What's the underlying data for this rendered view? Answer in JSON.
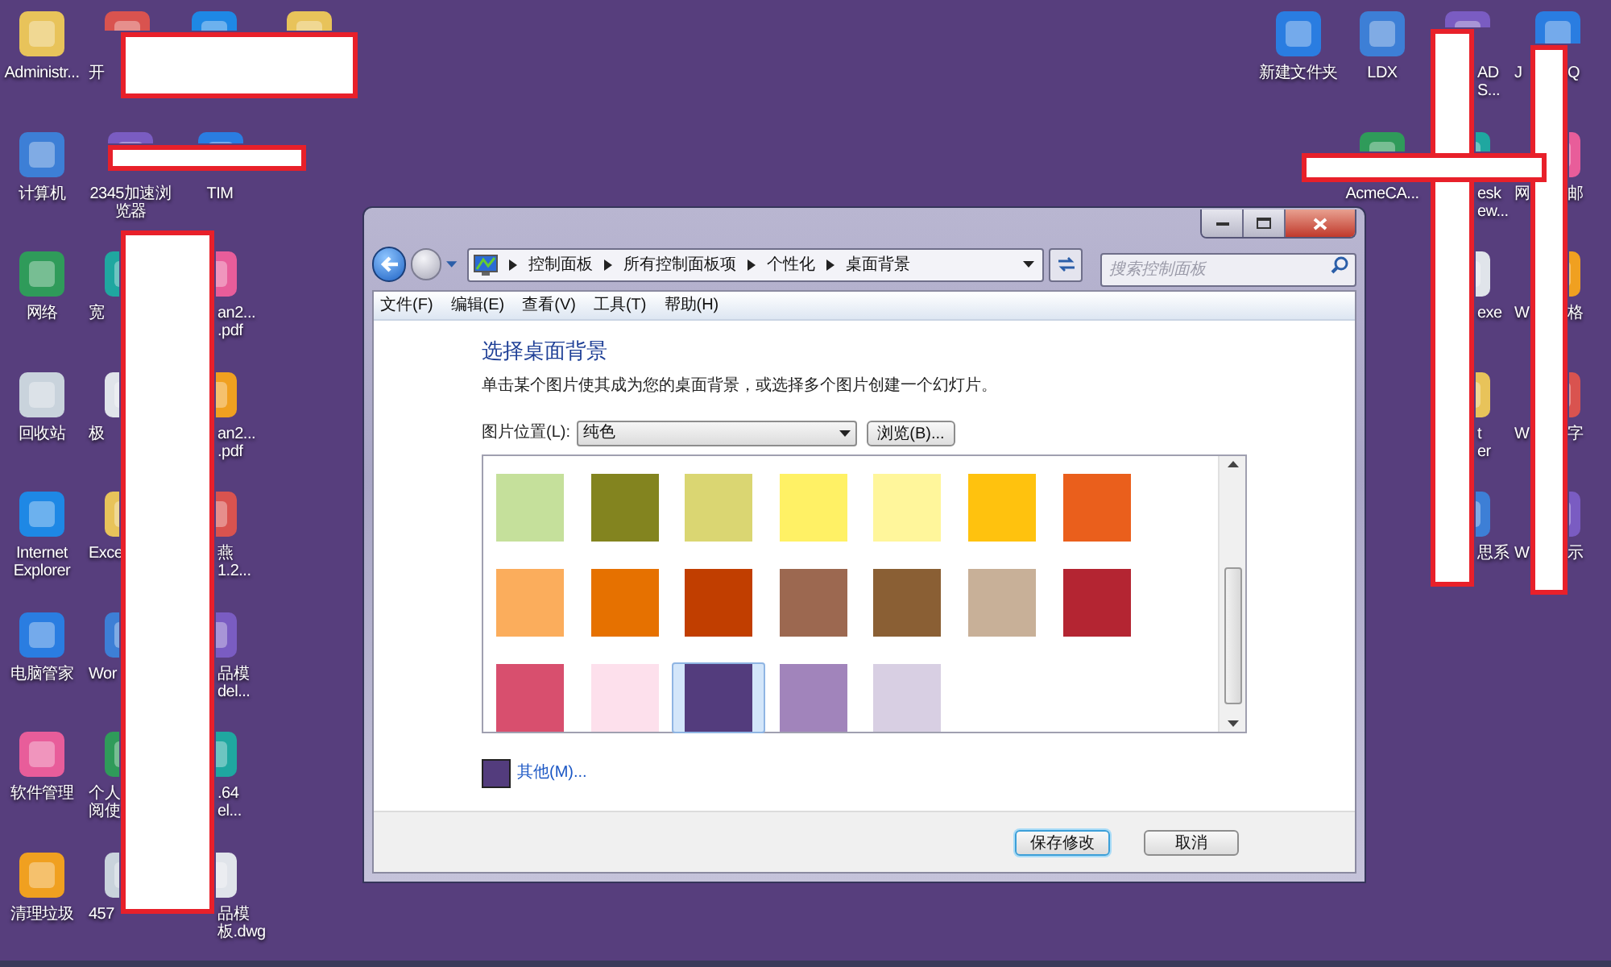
{
  "desktop": {
    "left_columns": [
      [
        {
          "kind": "full",
          "lines": [
            "Administr..."
          ]
        },
        {
          "kind": "full",
          "lines": [
            "计算机"
          ]
        },
        {
          "kind": "full",
          "lines": [
            "网络"
          ]
        },
        {
          "kind": "full",
          "lines": [
            "回收站"
          ]
        },
        {
          "kind": "full",
          "lines": [
            "Internet",
            "Explorer"
          ]
        },
        {
          "kind": "full",
          "lines": [
            "电脑管家"
          ]
        },
        {
          "kind": "full",
          "lines": [
            "软件管理"
          ]
        },
        {
          "kind": "full",
          "lines": [
            "清理垃圾"
          ]
        }
      ],
      [
        {
          "kind": "cut_right",
          "lines": [
            "开"
          ]
        },
        {
          "kind": "full",
          "lines": [
            "2345加速浏",
            "览器"
          ]
        },
        {
          "kind": "cut_right",
          "lines": [
            "宽"
          ]
        },
        {
          "kind": "cut_right",
          "lines": [
            "极"
          ]
        },
        {
          "kind": "cut_right",
          "lines": [
            "Exce"
          ]
        },
        {
          "kind": "cut_right",
          "lines": [
            "Wor"
          ]
        },
        {
          "kind": "cut_right",
          "lines": [
            "个人",
            "阅使"
          ]
        },
        {
          "kind": "cut_right",
          "lines": [
            "457"
          ]
        }
      ],
      [
        {
          "kind": "icon_only"
        },
        {
          "kind": "full",
          "lines": [
            "TIM"
          ]
        },
        {
          "kind": "cut_left",
          "lines": [
            "an2...",
            ".pdf"
          ]
        },
        {
          "kind": "cut_left",
          "lines": [
            "an2...",
            ".pdf"
          ]
        },
        {
          "kind": "cut_left",
          "lines": [
            "燕",
            "1.2..."
          ]
        },
        {
          "kind": "cut_left",
          "lines": [
            "品模",
            "del..."
          ]
        },
        {
          "kind": "cut_left",
          "lines": [
            ".64",
            "el..."
          ]
        },
        {
          "kind": "cut_left",
          "lines": [
            "品模",
            "板.dwg"
          ]
        }
      ],
      [
        {
          "kind": "icon_only"
        }
      ]
    ],
    "right_columns": [
      [
        {
          "kind": "full",
          "lines": [
            "新建文件夹"
          ]
        }
      ],
      [
        {
          "kind": "full",
          "lines": [
            "LDX"
          ]
        },
        {
          "kind": "full",
          "lines": [
            "AcmeCA..."
          ]
        }
      ],
      [
        {
          "kind": "cut_left",
          "lines": [
            "AD",
            "S..."
          ]
        },
        {
          "kind": "cut_left",
          "lines": [
            "esk",
            "ew..."
          ]
        },
        {
          "kind": "cut_left",
          "lines": [
            "exe"
          ]
        },
        {
          "kind": "cut_left",
          "lines": [
            "t",
            "er"
          ]
        },
        {
          "kind": "cut_left",
          "lines": [
            "思系"
          ]
        }
      ],
      [
        {
          "kind": "split",
          "left": "J",
          "right": "Q"
        },
        {
          "kind": "split",
          "left": "网",
          "right": "邮"
        },
        {
          "kind": "split",
          "left": "W",
          "right": "格"
        },
        {
          "kind": "split",
          "left": "W",
          "right": "字"
        },
        {
          "kind": "split",
          "left": "W",
          "right": "示"
        }
      ]
    ]
  },
  "window": {
    "breadcrumb": [
      "控制面板",
      "所有控制面板项",
      "个性化",
      "桌面背景"
    ],
    "search": {
      "placeholder": "搜索控制面板"
    },
    "menu": [
      "文件(F)",
      "编辑(E)",
      "查看(V)",
      "工具(T)",
      "帮助(H)"
    ],
    "heading": "选择桌面背景",
    "description": "单击某个图片使其成为您的桌面背景，或选择多个图片创建一个幻灯片。",
    "location": {
      "label": "图片位置(L):",
      "value": "纯色"
    },
    "browse_button": "浏览(B)...",
    "swatches": [
      {
        "color": "#c5e09b",
        "selected": false
      },
      {
        "color": "#83841f",
        "selected": false
      },
      {
        "color": "#dad672",
        "selected": false
      },
      {
        "color": "#fff165",
        "selected": false
      },
      {
        "color": "#fff69b",
        "selected": false
      },
      {
        "color": "#ffc20e",
        "selected": false
      },
      {
        "color": "#ea5f1c",
        "selected": false
      },
      {
        "color": "#fbad5c",
        "selected": false
      },
      {
        "color": "#e67100",
        "selected": false
      },
      {
        "color": "#c13e00",
        "selected": false
      },
      {
        "color": "#9c6850",
        "selected": false
      },
      {
        "color": "#8a5f34",
        "selected": false
      },
      {
        "color": "#c8b098",
        "selected": false
      },
      {
        "color": "#b42532",
        "selected": false
      },
      {
        "color": "#d84f6e",
        "selected": false
      },
      {
        "color": "#fde0ec",
        "selected": false
      },
      {
        "color": "#533c7d",
        "selected": true
      },
      {
        "color": "#a184bb",
        "selected": false
      },
      {
        "color": "#d8cfe3",
        "selected": false
      }
    ],
    "more_colors": {
      "label": "其他(M)...",
      "color": "#533c7d"
    },
    "buttons": [
      {
        "label": "保存修改",
        "default": true
      },
      {
        "label": "取消",
        "default": false
      }
    ]
  }
}
